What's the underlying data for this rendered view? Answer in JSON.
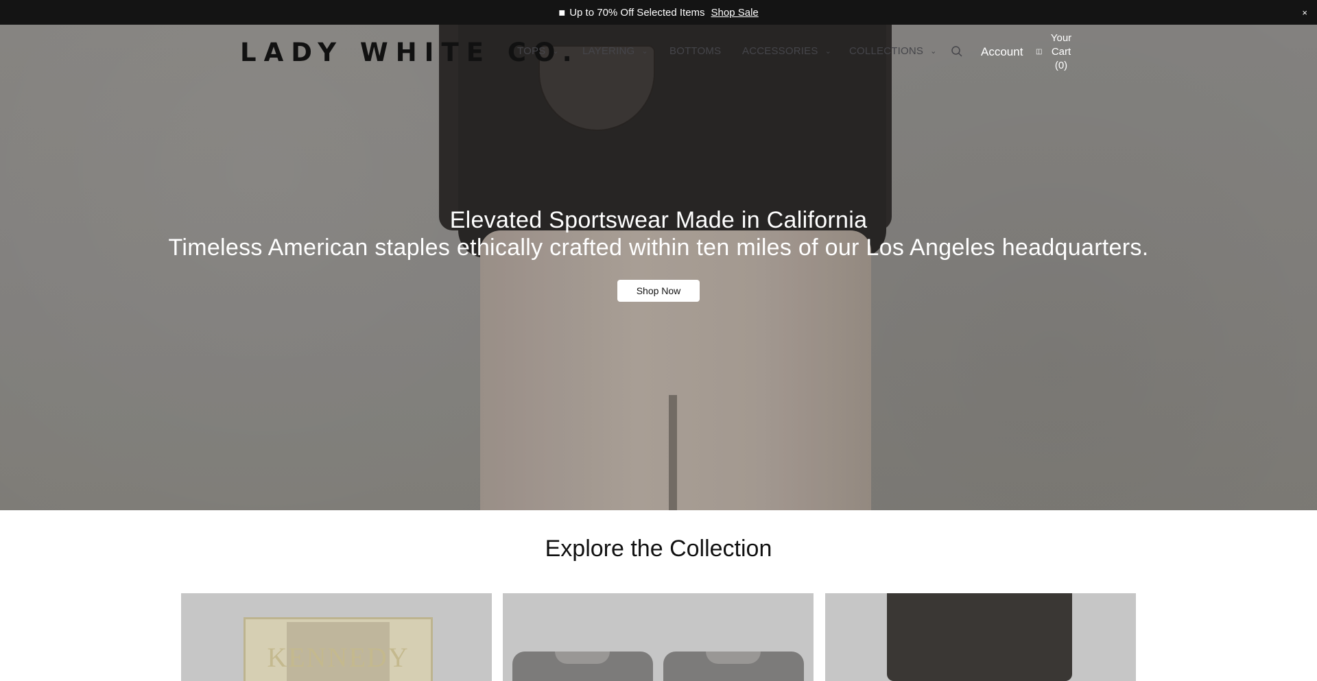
{
  "announcement": {
    "icon": "tag-icon",
    "text": "Up to 70% Off Selected Items",
    "link": "Shop Sale",
    "close": "×"
  },
  "header": {
    "logo": "LADY WHITE CO.",
    "nav": [
      {
        "label": "TOPS",
        "has_dropdown": true
      },
      {
        "label": "LAYERING",
        "has_dropdown": true
      },
      {
        "label": "BOTTOMS",
        "has_dropdown": false
      },
      {
        "label": "ACCESSORIES",
        "has_dropdown": true
      },
      {
        "label": "COLLECTIONS",
        "has_dropdown": true
      }
    ],
    "search_icon": "search-icon",
    "account": "Account",
    "cart": {
      "line1": "Your",
      "line2": "Cart",
      "line3": "(0)"
    }
  },
  "hero": {
    "title": "Elevated Sportswear Made in California",
    "subtitle": "Timeless American staples ethically crafted within ten miles of our Los Angeles headquarters.",
    "cta": "Shop Now"
  },
  "collection": {
    "title": "Explore the Collection",
    "cards": [
      {
        "image_text": "KENNEDY"
      },
      {
        "image_text": ""
      },
      {
        "image_text": ""
      }
    ]
  },
  "colors": {
    "announcement_bg": "#141414",
    "hero_text": "#ffffff",
    "button_bg": "#ffffff",
    "card_bg": "#c6c6c6"
  }
}
